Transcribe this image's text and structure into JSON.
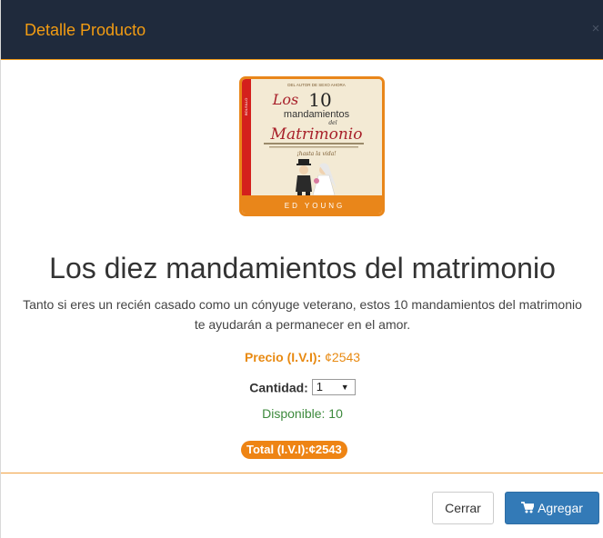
{
  "modal": {
    "title": "Detalle Producto",
    "close_glyph": "×"
  },
  "product": {
    "cover": {
      "top_small": "DEL AUTOR DE SEXO AHORA",
      "le": "Los",
      "num": "10",
      "mandamientos": "mandamientos",
      "del": "del",
      "matrimonio": "Matrimonio",
      "tagline": "¡hasta la vida!",
      "author": "ED YOUNG",
      "spine": "BOLSILLO",
      "bg_color": "#f3ead4",
      "border_color": "#e9861a"
    },
    "title": "Los diez mandamientos del matrimonio",
    "description": "Tanto si eres un recién casado como un cónyuge veterano, estos 10 mandamientos del matrimonio te ayudarán a permanecer en el amor.",
    "price_label": "Precio (I.V.I):",
    "price_value": "¢2543",
    "quantity_label": "Cantidad:",
    "quantity_selected": "1",
    "availability": "Disponible: 10",
    "total_label": "Total (I.V.I):¢2543"
  },
  "footer": {
    "close_label": "Cerrar",
    "add_label": "Agregar",
    "add_icon": "shopping-cart-icon"
  },
  "colors": {
    "header_bg": "#1f2a3c",
    "accent_orange": "#f39c12",
    "primary_blue": "#337ab7",
    "available_green": "#3d8a3d"
  }
}
